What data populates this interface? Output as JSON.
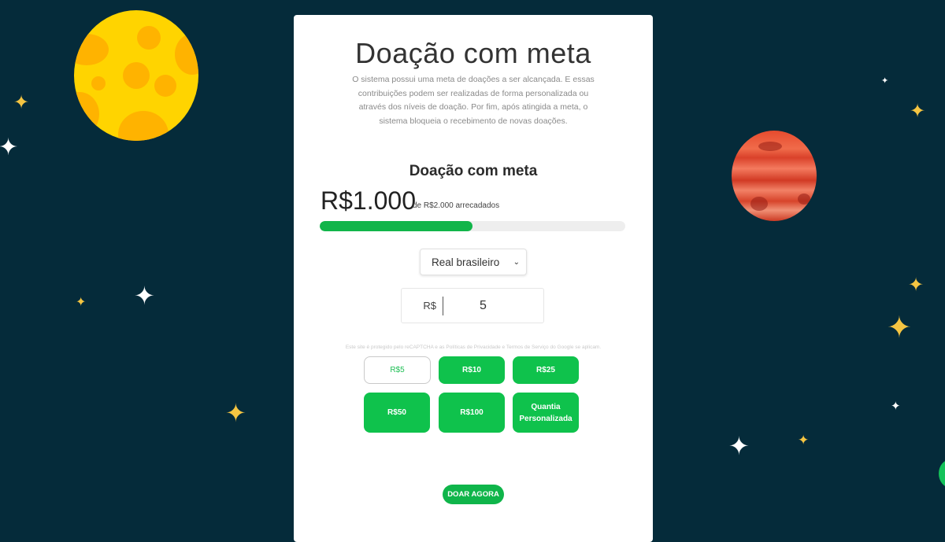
{
  "page": {
    "title": "Doação com meta",
    "description": "O sistema possui uma meta de doações a ser alcançada. E essas contribuições podem ser realizadas de forma personalizada ou através dos níveis de doação. Por fim, após atingida a meta, o sistema bloqueia o recebimento de novas doações."
  },
  "campaign": {
    "title": "Doação com meta",
    "raised": "R$1.000",
    "goal_text": "de R$2.000 arrecadados",
    "progress_fraction": 0.5
  },
  "currency_select": {
    "selected": "Real brasileiro"
  },
  "amount_input": {
    "prefix": "R$",
    "value": "5"
  },
  "recaptcha_notice": "Este site é protegido pelo reCAPTCHA e as Políticas de Privacidade e Termos de Serviço do Google se aplicam.",
  "amount_buttons": [
    "R$5",
    "R$10",
    "R$25",
    "R$50",
    "R$100",
    "Quantia Personalizada"
  ],
  "donate_button": "DOAR AGORA",
  "colors": {
    "background": "#052b3a",
    "accent_green": "#0fc24c",
    "moon": "#ffd400",
    "planet": "#e64b2e",
    "star_gold": "#f5c542"
  }
}
